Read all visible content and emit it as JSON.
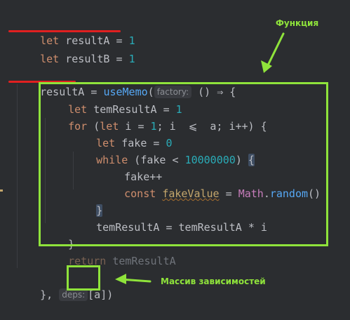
{
  "code": {
    "line1": {
      "kw": "let",
      "name": "resultA",
      "eq": " = ",
      "val": "1"
    },
    "line2": {
      "kw": "let",
      "name": "resultB",
      "eq": " = ",
      "val": "1"
    },
    "line4": {
      "name": "resultA",
      "eq": " = ",
      "fn": "useMemo",
      "paren": "(",
      "hint": "factory:",
      "arrow": " () ⇒ {"
    },
    "line5": {
      "kw": "let",
      "name": "temResultA",
      "eq": " = ",
      "val": "1"
    },
    "line6": {
      "kw": "for",
      "open": " (",
      "kw2": "let",
      "rest1": " i = ",
      "n1": "1",
      "rest2": "; i  ⩽  a; i++) {"
    },
    "line7": {
      "kw": "let",
      "name": "fake",
      "eq": " = ",
      "val": "0"
    },
    "line8": {
      "kw": "while",
      "open": " (fake < ",
      "val": "10000000",
      "close": ")",
      "brace": "{"
    },
    "line9": {
      "text": "fake++"
    },
    "line10": {
      "kw": "const",
      "name": "fakeValue",
      "eq": " = ",
      "cls": "Math",
      "dot": ".",
      "fn": "random",
      "call": "()"
    },
    "line11": {
      "brace": "}"
    },
    "line12": {
      "text": "temResultA = temResultA * i"
    },
    "line13": {
      "brace": "}"
    },
    "line14": {
      "kw": "return",
      "name": " temResultA"
    },
    "line16": {
      "close": "},",
      "hint": "deps:",
      "arr": "[a]",
      "paren": ")"
    }
  },
  "annotations": {
    "function_label": "Функция",
    "deps_label": "Массив зависимостей"
  },
  "colors": {
    "annotation_green": "#8fe33b",
    "underline_red": "#e02020",
    "background": "#2b2d30"
  }
}
